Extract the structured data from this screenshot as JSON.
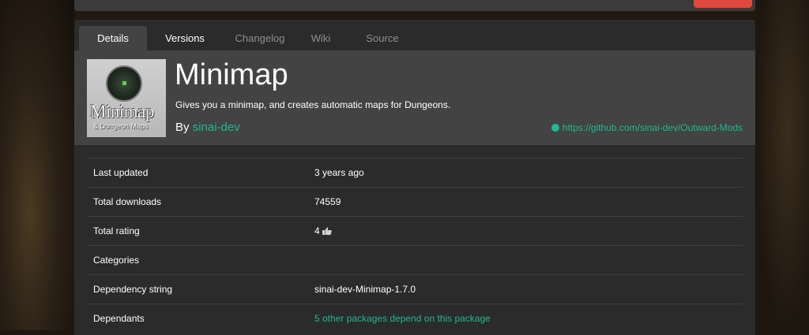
{
  "tabs": [
    {
      "label": "Details"
    },
    {
      "label": "Versions"
    },
    {
      "label": "Changelog"
    },
    {
      "label": "Wiki"
    },
    {
      "label": "Source"
    }
  ],
  "package": {
    "thumbnail_title": "Minimap",
    "thumbnail_subtitle": "& Dungeon Maps",
    "name": "Minimap",
    "description": "Gives you a minimap, and creates automatic maps for Dungeons.",
    "by_label": "By",
    "author": "sinai-dev",
    "website": "https://github.com/sinai-dev/Outward-Mods",
    "website_icon": "globe-icon"
  },
  "details": [
    {
      "label": "Last updated",
      "value": "3 years ago"
    },
    {
      "label": "Total downloads",
      "value": "74559"
    },
    {
      "label": "Total rating",
      "value": "4",
      "icon": "thumbs-up-icon"
    },
    {
      "label": "Categories",
      "value": ""
    },
    {
      "label": "Dependency string",
      "value": "sinai-dev-Minimap-1.7.0"
    },
    {
      "label": "Dependants",
      "value": "5 other packages depend on this package"
    }
  ],
  "colors": {
    "accent": "#1fb890",
    "panel": "#2b2b2b",
    "header": "#434343",
    "danger": "#e0483e"
  }
}
